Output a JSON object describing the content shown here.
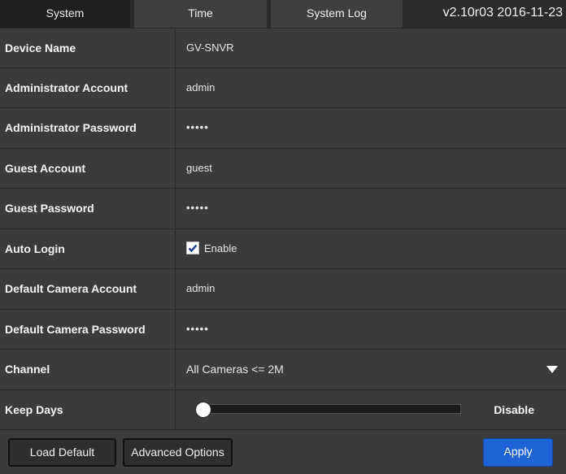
{
  "tabs": [
    {
      "label": "System",
      "active": true
    },
    {
      "label": "Time",
      "active": false
    },
    {
      "label": "System Log",
      "active": false
    }
  ],
  "version": "v2.10r03 2016-11-23",
  "fields": {
    "device_name": {
      "label": "Device Name",
      "value": "GV-SNVR"
    },
    "admin_account": {
      "label": "Administrator Account",
      "value": "admin"
    },
    "admin_password": {
      "label": "Administrator Password",
      "value": "•••••"
    },
    "guest_account": {
      "label": "Guest Account",
      "value": "guest"
    },
    "guest_password": {
      "label": "Guest Password",
      "value": "•••••"
    },
    "auto_login": {
      "label": "Auto Login",
      "checkbox_label": "Enable",
      "checked": true
    },
    "camera_account": {
      "label": "Default Camera Account",
      "value": "admin"
    },
    "camera_password": {
      "label": "Default Camera Password",
      "value": "•••••"
    },
    "channel": {
      "label": "Channel",
      "selected": "All Cameras <= 2M"
    },
    "keep_days": {
      "label": "Keep Days",
      "value_text": "Disable",
      "level": 0
    }
  },
  "buttons": {
    "load_default": "Load Default",
    "advanced_options": "Advanced Options",
    "apply": "Apply"
  },
  "colors": {
    "accent": "#1e64d6",
    "background": "#3b3b3b",
    "active_tab": "#1f1f1f"
  }
}
